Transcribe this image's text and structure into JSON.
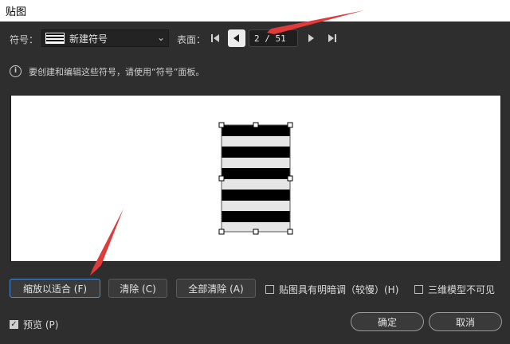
{
  "window": {
    "title": "贴图"
  },
  "toolbar": {
    "symbol_label": "符号：",
    "symbol_value": "新建符号",
    "surface_label": "表面：",
    "page_value": "2 / 51"
  },
  "info": {
    "text": "要创建和编辑这些符号，请使用“符号”面板。"
  },
  "buttons": {
    "fit": "缩放以适合 (F)",
    "clear": "清除 (C)",
    "clear_all": "全部清除 (A)",
    "ok": "确定",
    "cancel": "取消"
  },
  "options": {
    "shade_label": "贴图具有明暗调（较慢）(H)",
    "shade_checked": false,
    "invisible_label": "三维模型不可见",
    "invisible_checked": false,
    "preview_label": "预览 (P)",
    "preview_checked": true
  },
  "colors": {
    "accent": "#4a8bd4",
    "annotation_arrow": "#e03a3a"
  }
}
